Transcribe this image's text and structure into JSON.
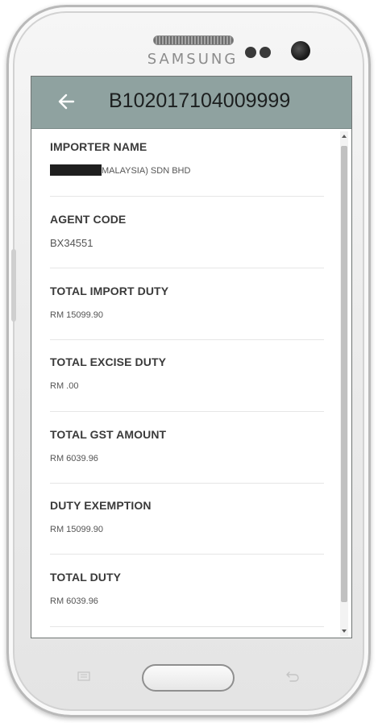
{
  "device": {
    "brand": "SAMSUNG"
  },
  "appbar": {
    "title": "B102017104009999",
    "back_icon": "arrow-left-icon"
  },
  "fields": [
    {
      "key": "importer_name",
      "label": "IMPORTER NAME",
      "value": "MALAYSIA) SDN BHD",
      "redacted_prefix": true
    },
    {
      "key": "agent_code",
      "label": "AGENT CODE",
      "value": "BX34551"
    },
    {
      "key": "total_import_duty",
      "label": "TOTAL IMPORT DUTY",
      "value": "RM 15099.90"
    },
    {
      "key": "total_excise_duty",
      "label": "TOTAL EXCISE DUTY",
      "value": "RM .00"
    },
    {
      "key": "total_gst_amount",
      "label": "TOTAL GST AMOUNT",
      "value": "RM 6039.96"
    },
    {
      "key": "duty_exemption",
      "label": "DUTY EXEMPTION",
      "value": "RM 15099.90"
    },
    {
      "key": "total_duty",
      "label": "TOTAL DUTY",
      "value": "RM 6039.96"
    }
  ],
  "colors": {
    "appbar": "#8fa2a0",
    "screen_bg": "#ffffff",
    "label_text": "#3a3a3a",
    "value_text": "#555555"
  },
  "icons": {
    "menu_key": "menu-key-icon",
    "home_key": "home-button",
    "back_key": "back-key-icon"
  }
}
